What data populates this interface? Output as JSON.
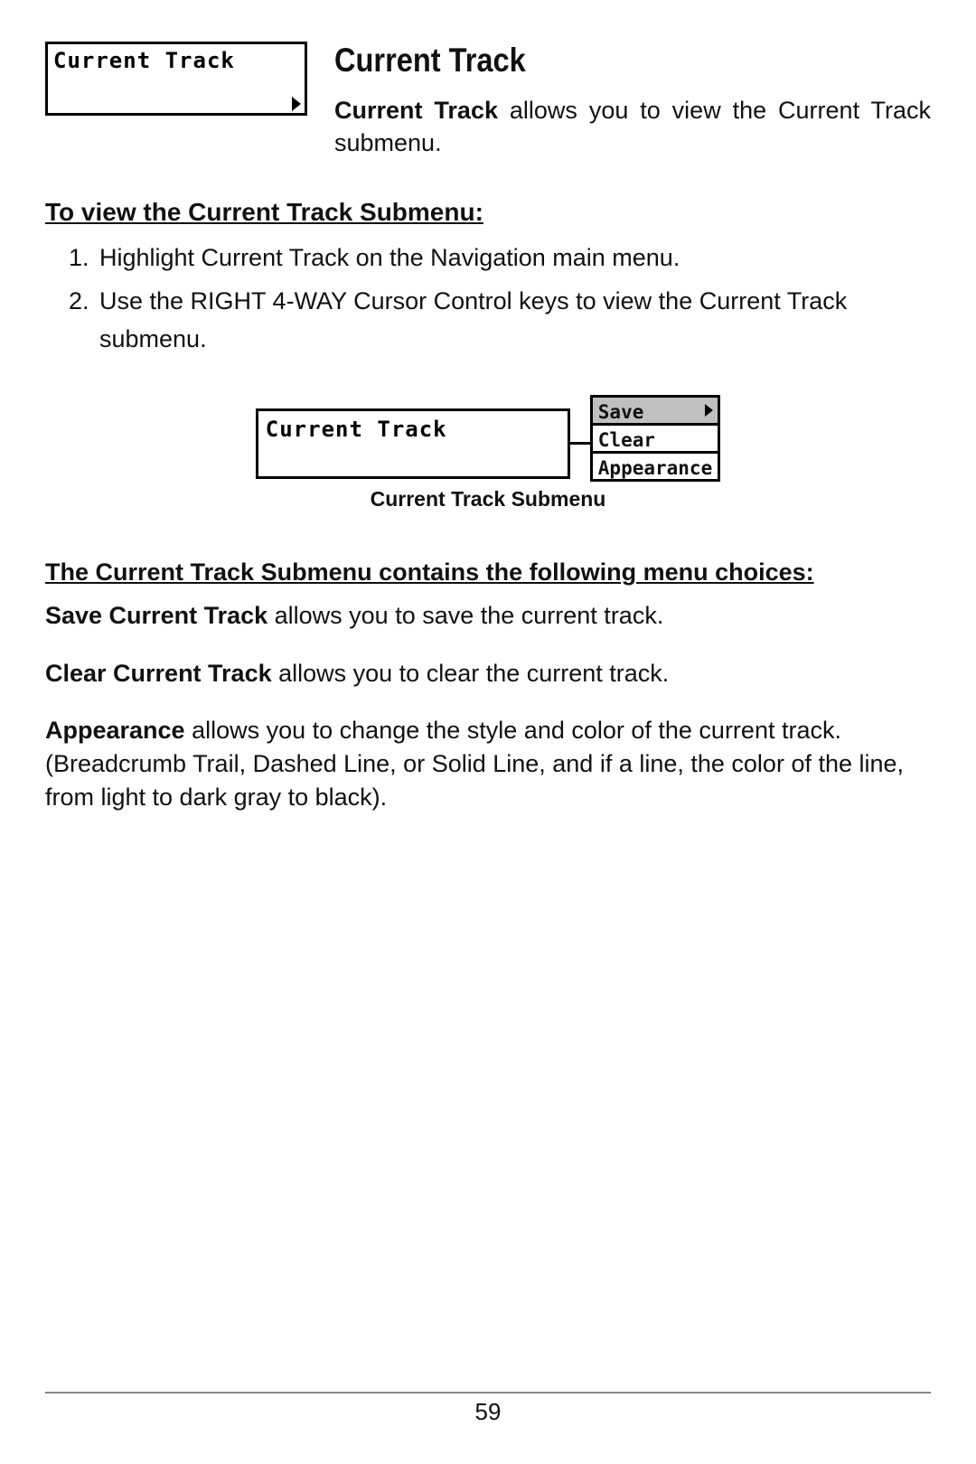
{
  "heading": "Current Track",
  "menu_panel_label": "Current Track",
  "intro": {
    "bold": "Current Track",
    "rest": " allows you to view the Current Track submenu."
  },
  "view_submenu_head": "To view the Current Track Submenu:",
  "steps": [
    "Highlight Current Track on the Navigation main menu.",
    "Use the RIGHT 4-WAY Cursor Control keys to view the Current Track submenu."
  ],
  "submenu_figure": {
    "parent_label": "Current Track",
    "items": [
      "Save",
      "Clear",
      "Appearance"
    ],
    "selected_index": 0,
    "caption": "Current Track Submenu"
  },
  "choices_head": "The Current Track Submenu contains the following menu choices:",
  "choices": [
    {
      "bold": "Save Current Track",
      "rest": " allows you to save the current track."
    },
    {
      "bold": "Clear Current Track",
      "rest": " allows you to clear the current track."
    },
    {
      "bold": "Appearance",
      "rest": " allows you to change the style and color of the current track. (Breadcrumb Trail, Dashed Line, or Solid Line, and if a line, the color of the line, from light to dark gray to black)."
    }
  ],
  "page_number": "59"
}
